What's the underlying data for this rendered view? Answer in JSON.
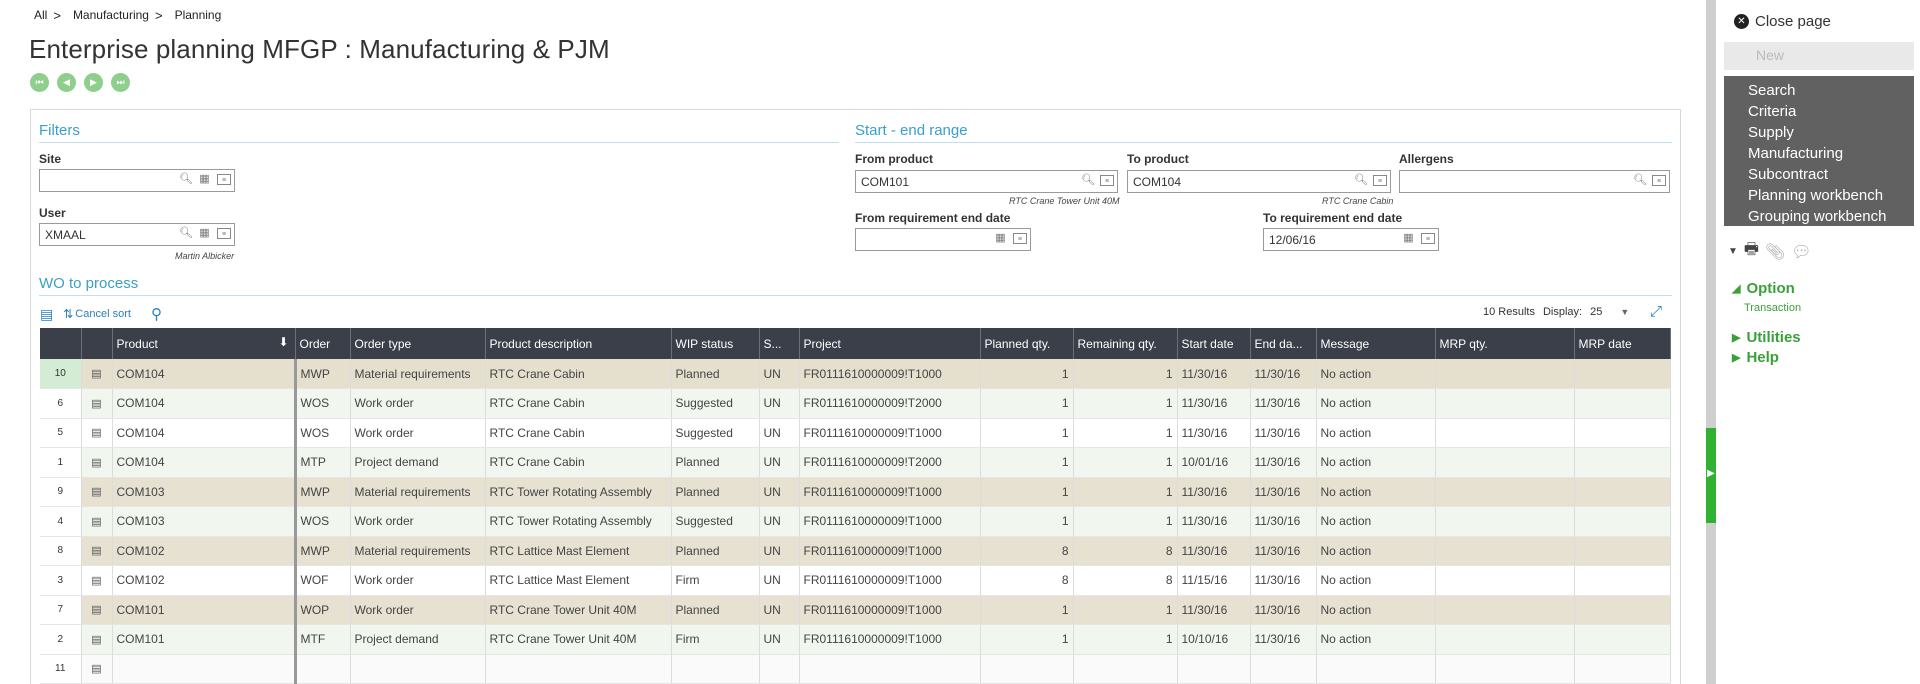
{
  "breadcrumb": {
    "items": [
      "All",
      "Manufacturing",
      "Planning"
    ],
    "separator": ">"
  },
  "page_title": "Enterprise planning MFGP : Manufacturing & PJM",
  "filters": {
    "title": "Filters",
    "site": {
      "label": "Site",
      "value": ""
    },
    "user": {
      "label": "User",
      "value": "XMAAL",
      "hint": "Martin Albicker"
    }
  },
  "range": {
    "title": "Start - end range",
    "from_product": {
      "label": "From product",
      "value": "COM101",
      "hint": "RTC Crane Tower Unit 40M"
    },
    "to_product": {
      "label": "To product",
      "value": "COM104",
      "hint": "RTC Crane Cabin"
    },
    "allergens": {
      "label": "Allergens",
      "value": ""
    },
    "from_req_end": {
      "label": "From requirement end date",
      "value": ""
    },
    "to_req_end": {
      "label": "To requirement end date",
      "value": "12/06/16"
    }
  },
  "grid": {
    "title": "WO to process",
    "cancel_sort": "Cancel sort",
    "results": "10 Results",
    "display_label": "Display:",
    "display_value": "25",
    "columns": [
      "Product",
      "Order",
      "Order type",
      "Product description",
      "WIP status",
      "S...",
      "Project",
      "Planned qty.",
      "Remaining qty.",
      "Start date",
      "End da...",
      "Message",
      "MRP qty.",
      "MRP date"
    ],
    "rows": [
      {
        "n": "10",
        "product": "COM104",
        "order": "MWP",
        "type": "Material requirements",
        "desc": "RTC Crane Cabin",
        "wip": "Planned",
        "s": "UN",
        "project": "FR0111610000009!T1000",
        "planned": "1",
        "remaining": "1",
        "start": "11/30/16",
        "end": "11/30/16",
        "message": "No action",
        "mrpqty": "",
        "mrpdate": ""
      },
      {
        "n": "6",
        "product": "COM104",
        "order": "WOS",
        "type": "Work order",
        "desc": "RTC Crane Cabin",
        "wip": "Suggested",
        "s": "UN",
        "project": "FR0111610000009!T2000",
        "planned": "1",
        "remaining": "1",
        "start": "11/30/16",
        "end": "11/30/16",
        "message": "No action",
        "mrpqty": "",
        "mrpdate": ""
      },
      {
        "n": "5",
        "product": "COM104",
        "order": "WOS",
        "type": "Work order",
        "desc": "RTC Crane Cabin",
        "wip": "Suggested",
        "s": "UN",
        "project": "FR0111610000009!T1000",
        "planned": "1",
        "remaining": "1",
        "start": "11/30/16",
        "end": "11/30/16",
        "message": "No action",
        "mrpqty": "",
        "mrpdate": ""
      },
      {
        "n": "1",
        "product": "COM104",
        "order": "MTP",
        "type": "Project demand",
        "desc": "RTC Crane Cabin",
        "wip": "Planned",
        "s": "UN",
        "project": "FR0111610000009!T2000",
        "planned": "1",
        "remaining": "1",
        "start": "10/01/16",
        "end": "11/30/16",
        "message": "No action",
        "mrpqty": "",
        "mrpdate": ""
      },
      {
        "n": "9",
        "product": "COM103",
        "order": "MWP",
        "type": "Material requirements",
        "desc": "RTC Tower Rotating Assembly",
        "wip": "Planned",
        "s": "UN",
        "project": "FR0111610000009!T1000",
        "planned": "1",
        "remaining": "1",
        "start": "11/30/16",
        "end": "11/30/16",
        "message": "No action",
        "mrpqty": "",
        "mrpdate": ""
      },
      {
        "n": "4",
        "product": "COM103",
        "order": "WOS",
        "type": "Work order",
        "desc": "RTC Tower Rotating Assembly",
        "wip": "Suggested",
        "s": "UN",
        "project": "FR0111610000009!T1000",
        "planned": "1",
        "remaining": "1",
        "start": "11/30/16",
        "end": "11/30/16",
        "message": "No action",
        "mrpqty": "",
        "mrpdate": ""
      },
      {
        "n": "8",
        "product": "COM102",
        "order": "MWP",
        "type": "Material requirements",
        "desc": "RTC Lattice Mast Element",
        "wip": "Planned",
        "s": "UN",
        "project": "FR0111610000009!T1000",
        "planned": "8",
        "remaining": "8",
        "start": "11/30/16",
        "end": "11/30/16",
        "message": "No action",
        "mrpqty": "",
        "mrpdate": ""
      },
      {
        "n": "3",
        "product": "COM102",
        "order": "WOF",
        "type": "Work order",
        "desc": "RTC Lattice Mast Element",
        "wip": "Firm",
        "s": "UN",
        "project": "FR0111610000009!T1000",
        "planned": "8",
        "remaining": "8",
        "start": "11/15/16",
        "end": "11/30/16",
        "message": "No action",
        "mrpqty": "",
        "mrpdate": ""
      },
      {
        "n": "7",
        "product": "COM101",
        "order": "WOP",
        "type": "Work order",
        "desc": "RTC Crane Tower Unit 40M",
        "wip": "Planned",
        "s": "UN",
        "project": "FR0111610000009!T1000",
        "planned": "1",
        "remaining": "1",
        "start": "11/30/16",
        "end": "11/30/16",
        "message": "No action",
        "mrpqty": "",
        "mrpdate": ""
      },
      {
        "n": "2",
        "product": "COM101",
        "order": "MTF",
        "type": "Project demand",
        "desc": "RTC Crane Tower Unit 40M",
        "wip": "Firm",
        "s": "UN",
        "project": "FR0111610000009!T1000",
        "planned": "1",
        "remaining": "1",
        "start": "10/10/16",
        "end": "11/30/16",
        "message": "No action",
        "mrpqty": "",
        "mrpdate": ""
      },
      {
        "n": "11",
        "product": "",
        "order": "",
        "type": "",
        "desc": "",
        "wip": "",
        "s": "",
        "project": "",
        "planned": "",
        "remaining": "",
        "start": "",
        "end": "",
        "message": "",
        "mrpqty": "",
        "mrpdate": ""
      }
    ]
  },
  "side": {
    "close_page": "Close page",
    "new": "New",
    "menu": [
      "Search",
      "Criteria",
      "Supply",
      "Manufacturing",
      "Subcontract",
      "Planning workbench",
      "Grouping workbench"
    ],
    "option": "Option",
    "transaction": "Transaction",
    "utilities": "Utilities",
    "help": "Help"
  },
  "colors": {
    "accent_blue": "#3aa0c8",
    "accent_green": "#3aa03a",
    "header_dark": "#3a3f4a",
    "menu_gray": "#616161"
  }
}
